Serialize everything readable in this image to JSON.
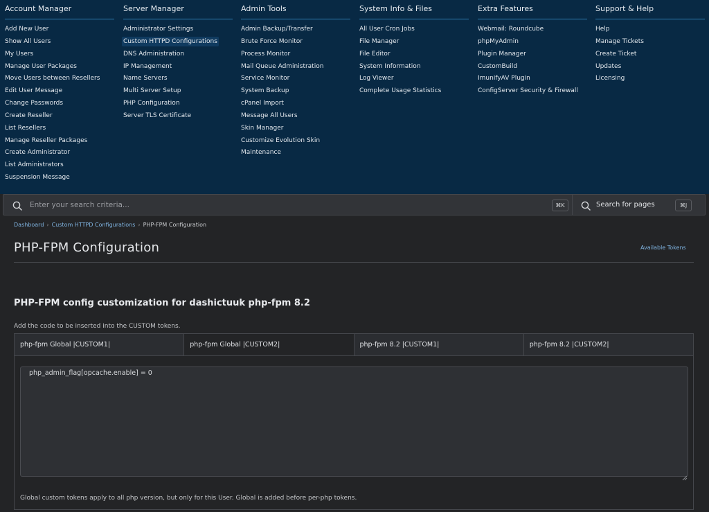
{
  "menu": {
    "columns": [
      {
        "title": "Account Manager",
        "items": [
          "Add New User",
          "Show All Users",
          "My Users",
          "Manage User Packages",
          "Move Users between Resellers",
          "Edit User Message",
          "Change Passwords",
          "Create Reseller",
          "List Resellers",
          "Manage Reseller Packages",
          "Create Administrator",
          "List Administrators",
          "Suspension Message"
        ]
      },
      {
        "title": "Server Manager",
        "items": [
          "Administrator Settings",
          "Custom HTTPD Configurations",
          "DNS Administration",
          "IP Management",
          "Name Servers",
          "Multi Server Setup",
          "PHP Configuration",
          "Server TLS Certificate"
        ],
        "active_index": 1
      },
      {
        "title": "Admin Tools",
        "items": [
          "Admin Backup/Transfer",
          "Brute Force Monitor",
          "Process Monitor",
          "Mail Queue Administration",
          "Service Monitor",
          "System Backup",
          "cPanel Import",
          "Message All Users",
          "Skin Manager",
          "Customize Evolution Skin",
          "Maintenance"
        ]
      },
      {
        "title": "System Info & Files",
        "items": [
          "All User Cron Jobs",
          "File Manager",
          "File Editor",
          "System Information",
          "Log Viewer",
          "Complete Usage Statistics"
        ]
      },
      {
        "title": "Extra Features",
        "items": [
          "Webmail: Roundcube",
          "phpMyAdmin",
          "Plugin Manager",
          "CustomBuild",
          "ImunifyAV Plugin",
          "ConfigServer Security & Firewall"
        ]
      },
      {
        "title": "Support & Help",
        "items": [
          "Help",
          "Manage Tickets",
          "Create Ticket",
          "Updates",
          "Licensing"
        ]
      }
    ]
  },
  "search": {
    "placeholder": "Enter your search criteria...",
    "shortcut": "⌘K",
    "pages_label": "Search for pages",
    "pages_shortcut": "⌘J"
  },
  "breadcrumb": {
    "items": [
      "Dashboard",
      "Custom HTTPD Configurations",
      "PHP-FPM Configuration"
    ]
  },
  "page": {
    "title": "PHP-FPM Configuration",
    "tokens_link": "Available Tokens",
    "section_title": "PHP-FPM config customization for dashictuuk php-fpm 8.2",
    "help_text": "Add the code to be inserted into the CUSTOM tokens.",
    "tabs": [
      "php-fpm Global |CUSTOM1|",
      "php-fpm Global |CUSTOM2|",
      "php-fpm 8.2 |CUSTOM1|",
      "php-fpm 8.2 |CUSTOM2|"
    ],
    "active_tab": 1,
    "code_value": "php_admin_flag[opcache.enable] = 0",
    "footnote": "Global custom tokens apply to all php version, but only for this User. Global is added before per-php tokens."
  },
  "colors": {
    "menu_bg": "#082944",
    "menu_accent": "#2f7fb6",
    "page_bg": "#232426",
    "link": "#7fb3e0"
  }
}
